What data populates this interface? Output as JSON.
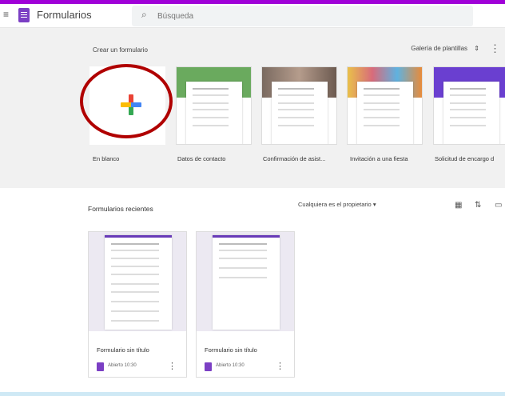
{
  "header": {
    "app_title": "Formularios",
    "search_placeholder": "Búsqueda"
  },
  "templates": {
    "section_title": "Crear un formulario",
    "gallery_label": "Galería de plantillas",
    "items": [
      {
        "label": "En blanco"
      },
      {
        "label": "Datos de contacto",
        "header_color": "#6aaa5e"
      },
      {
        "label": "Confirmación de asist...",
        "header_color": "#9a7f75"
      },
      {
        "label": "Invitación a una fiesta",
        "header_color": "#e0a060"
      },
      {
        "label": "Solicitud de encargo d",
        "header_color": "#6a3fd0"
      }
    ]
  },
  "recent": {
    "title": "Formularios recientes",
    "owner_filter": "Cualquiera es el propietario",
    "forms": [
      {
        "name": "Formulario sin título",
        "opened": "Abierto 10:30"
      },
      {
        "name": "Formulario sin título",
        "opened": "Abierto 10:30"
      }
    ]
  },
  "colors": {
    "accent": "#673ab7",
    "top_strip": "#a000d8",
    "highlight_circle": "#b00000"
  }
}
